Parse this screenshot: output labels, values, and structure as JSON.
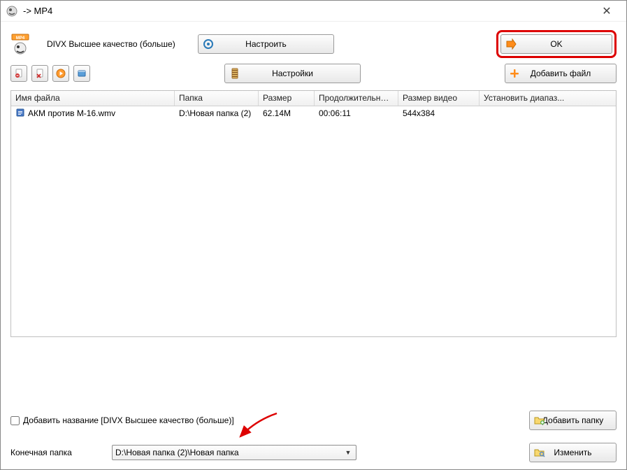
{
  "titlebar": {
    "title": "-> MP4"
  },
  "quality_label": "DIVX Высшее качество (больше)",
  "buttons": {
    "configure": "Настроить",
    "settings": "Настройки",
    "ok": "OK",
    "add_file": "Добавить файл",
    "add_folder": "Добавить папку",
    "change": "Изменить"
  },
  "table": {
    "headers": {
      "name": "Имя файла",
      "folder": "Папка",
      "size": "Размер",
      "duration": "Продолжительность",
      "video_size": "Размер видео",
      "range": "Установить диапаз..."
    },
    "rows": [
      {
        "name": "АКМ против М-16.wmv",
        "folder": "D:\\Новая папка (2)",
        "size": "62.14M",
        "duration": "00:06:11",
        "video_size": "544x384",
        "range": ""
      }
    ]
  },
  "add_title_checkbox": "Добавить название [DIVX Высшее качество (больше)]",
  "dest_label": "Конечная папка",
  "dest_path": "D:\\Новая папка (2)\\Новая папка"
}
